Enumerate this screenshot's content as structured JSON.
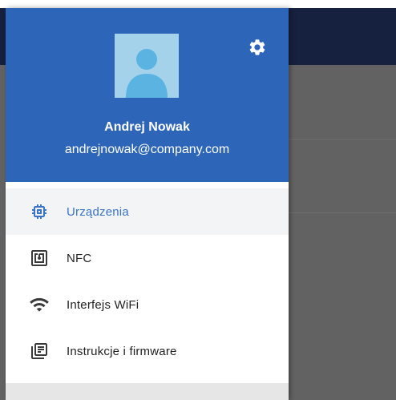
{
  "user": {
    "name": "Andrej Nowak",
    "email": "andrejnowak@company.com"
  },
  "menu": {
    "items": [
      {
        "label": "Urządzenia",
        "icon": "chip-icon",
        "active": true
      },
      {
        "label": "NFC",
        "icon": "nfc-icon",
        "active": false
      },
      {
        "label": "Interfejs WiFi",
        "icon": "wifi-icon",
        "active": false
      },
      {
        "label": "Instrukcje i firmware",
        "icon": "library-books-icon",
        "active": false
      }
    ]
  },
  "colors": {
    "header": "#2d66b8",
    "accent": "#3b73c6",
    "avatar_bg": "#a4d2ea",
    "app_topbar": "#15213f",
    "scrim": "#626262"
  }
}
